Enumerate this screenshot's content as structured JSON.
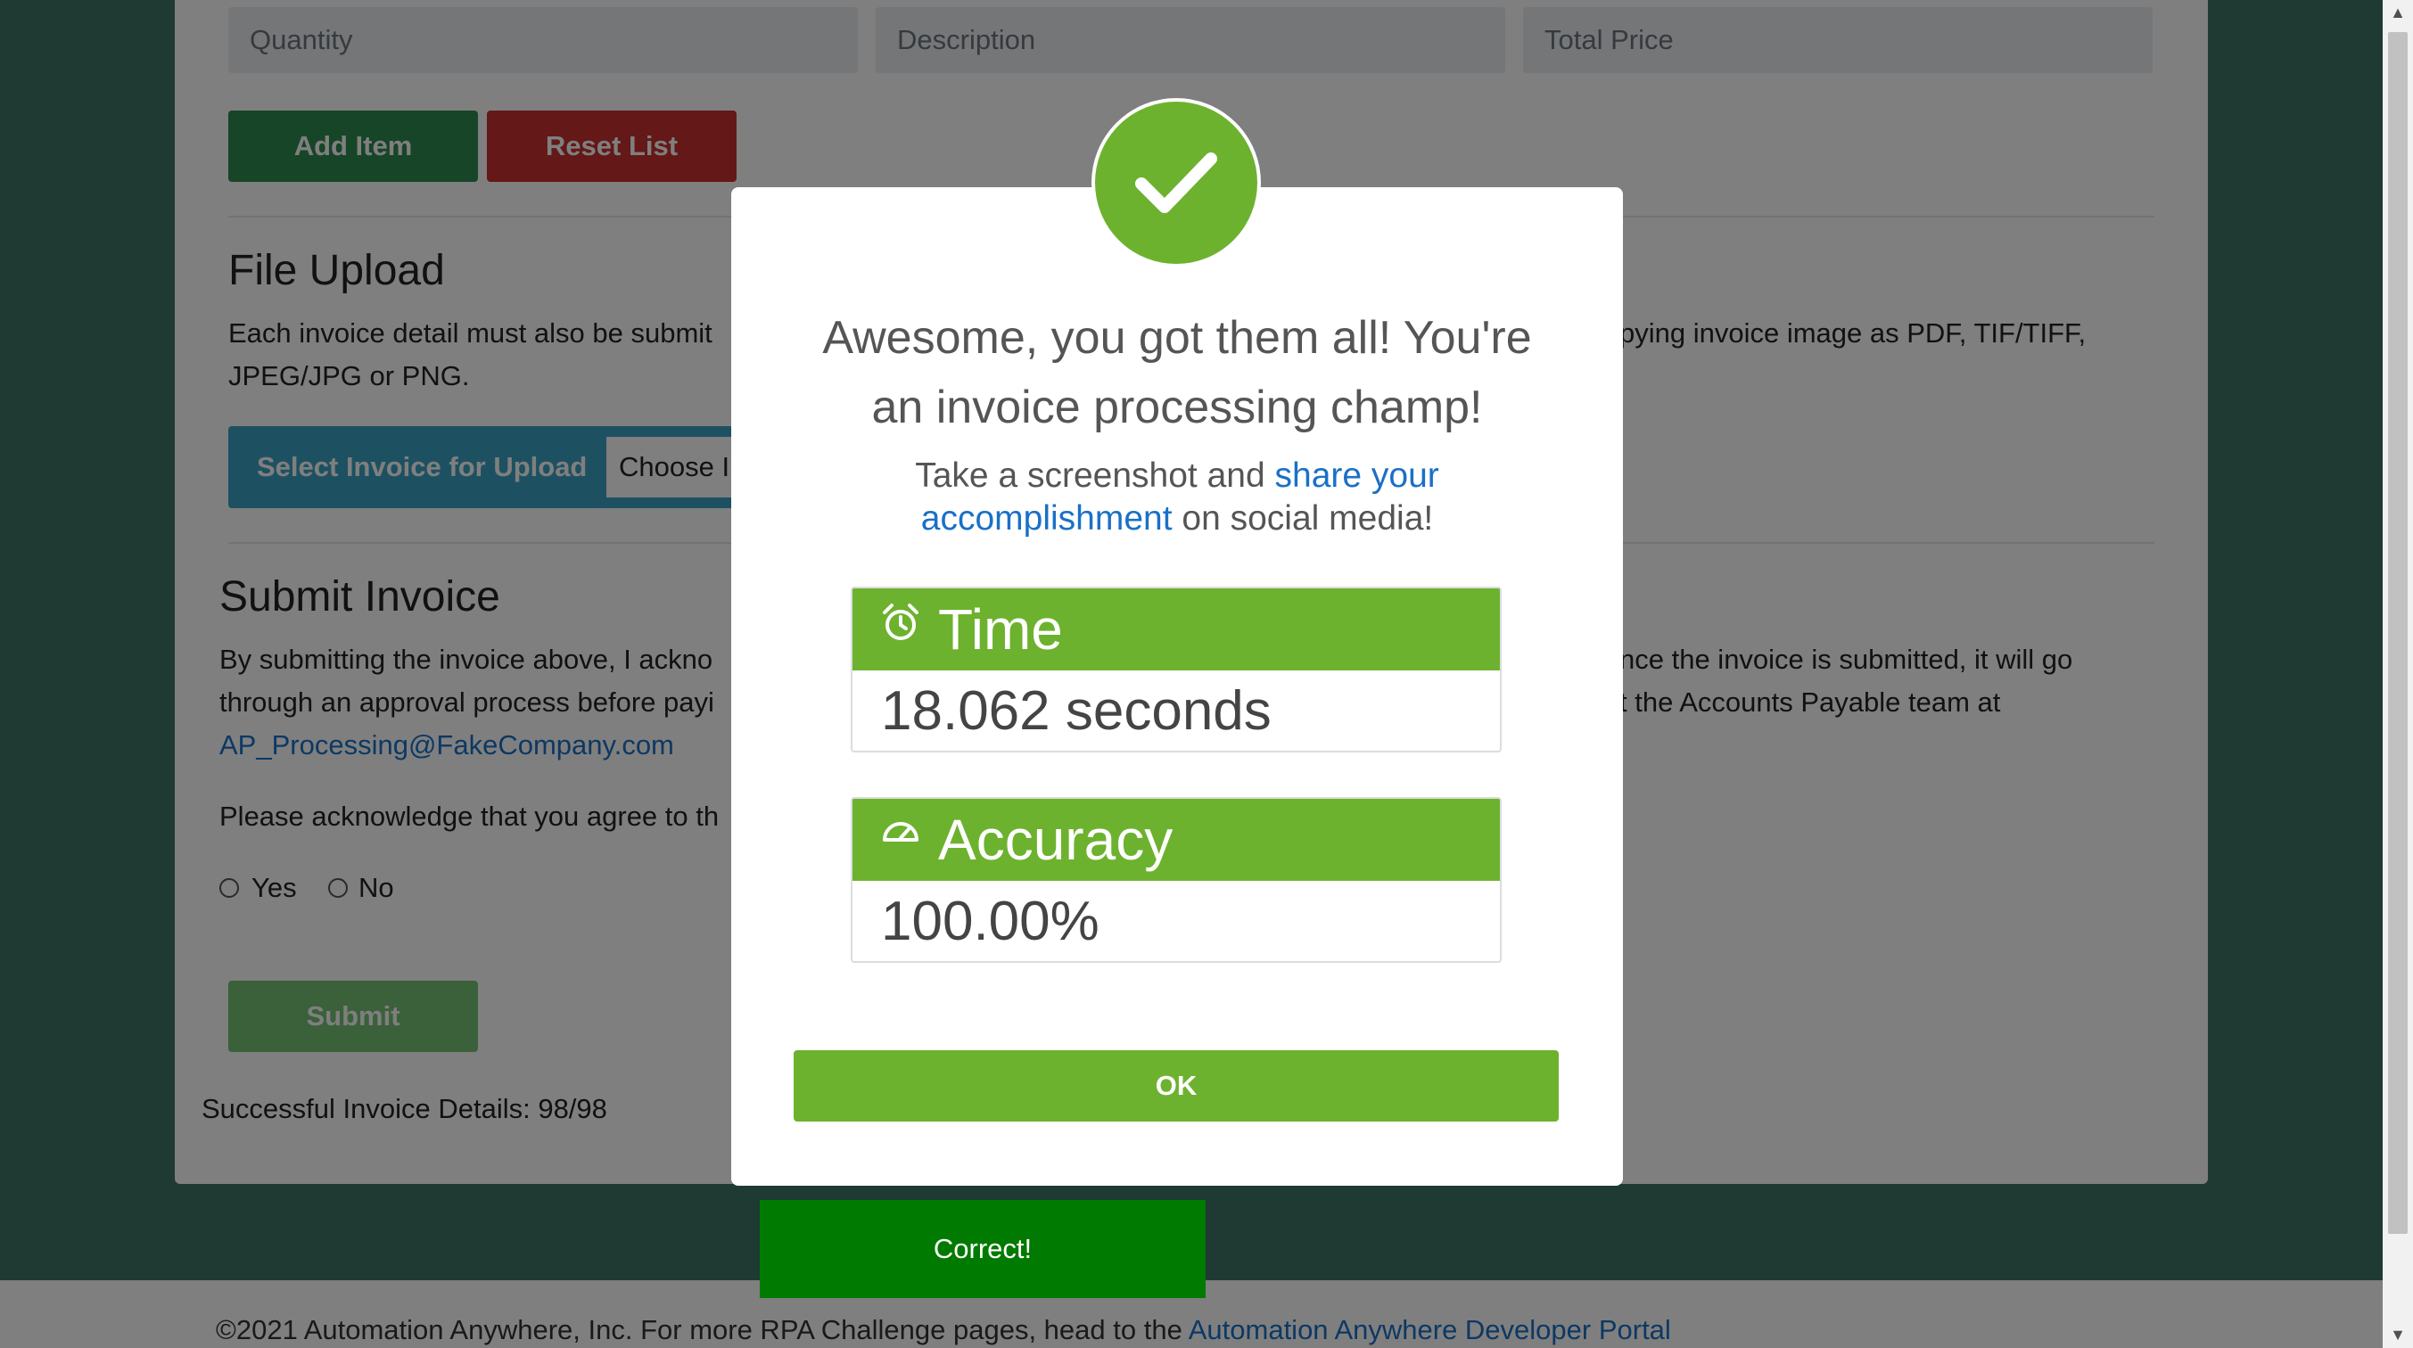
{
  "form": {
    "quantity_placeholder": "Quantity",
    "description_placeholder": "Description",
    "total_price_placeholder": "Total Price",
    "add_item_label": "Add Item",
    "reset_list_label": "Reset List"
  },
  "file_upload": {
    "heading": "File Upload",
    "text_line1": "Each invoice detail must also be submit",
    "text_line1_right": "pying invoice image as PDF, TIF/TIFF,",
    "text_line2": "JPEG/JPG or PNG.",
    "select_label": "Select Invoice for Upload",
    "choose_label": "Choose I"
  },
  "submit_invoice": {
    "heading": "Submit Invoice",
    "line1_left": "By submitting the invoice above, I ackno",
    "line1_right": "nce the invoice is submitted, it will go",
    "line2_left": "through an approval process before payi",
    "line2_right": "t the Accounts Payable team at",
    "email": "AP_Processing@FakeCompany.com",
    "acknowledge_text": "Please acknowledge that you agree to th",
    "yes_label": "Yes",
    "no_label": "No",
    "submit_label": "Submit",
    "success_text": "Successful Invoice Details: 98/98"
  },
  "toast": {
    "text": "Correct!"
  },
  "footer": {
    "text": "©2021 Automation Anywhere, Inc. For more RPA Challenge pages, head to the ",
    "link": "Automation Anywhere Developer Portal"
  },
  "modal": {
    "title_line1": "Awesome, you got them all! You're",
    "title_line2": "an invoice processing champ!",
    "sub_prefix": "Take a screenshot and ",
    "sub_link_line1": "share your",
    "sub_link_line2": "accomplishment",
    "sub_suffix": " on social media!",
    "time_label": "Time",
    "time_value": "18.062 seconds",
    "accuracy_label": "Accuracy",
    "accuracy_value": "100.00%",
    "ok_label": "OK"
  },
  "colors": {
    "background": "#3c7566",
    "add_button": "#2e8b4e",
    "reset_button": "#c9312f",
    "upload_bar": "#3aa2c4",
    "submit_button": "#5cb85c",
    "success_green": "#6db22e",
    "toast": "#007a00",
    "link": "#1a70c7"
  },
  "icons": [
    "checkmark-icon",
    "alarm-clock-icon",
    "gauge-icon",
    "scroll-up-arrow-icon",
    "scroll-down-arrow-icon"
  ]
}
